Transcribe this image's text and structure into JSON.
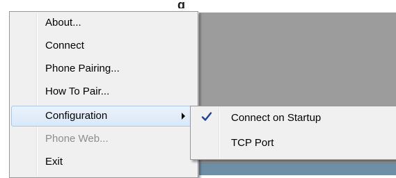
{
  "background": {
    "title_fragment": "g"
  },
  "menu": {
    "items": [
      {
        "label": "About...",
        "enabled": true
      },
      {
        "label": "Connect",
        "enabled": true
      },
      {
        "label": "Phone Pairing...",
        "enabled": true
      },
      {
        "label": "How To Pair...",
        "enabled": true
      },
      {
        "label": "Configuration",
        "enabled": true,
        "has_submenu": true,
        "highlighted": true
      },
      {
        "label": "Phone Web...",
        "enabled": false
      },
      {
        "label": "Exit",
        "enabled": true
      }
    ]
  },
  "submenu": {
    "items": [
      {
        "label": "Connect on Startup",
        "checked": true
      },
      {
        "label": "TCP Port",
        "checked": false
      }
    ]
  },
  "colors": {
    "menu_bg": "#f0f0f0",
    "highlight_border": "#a8c8eb",
    "disabled_text": "#8d8d8d",
    "checkmark": "#1f3f9f"
  },
  "icons": {
    "submenu_arrow": "chevron-right-icon",
    "check": "checkmark-icon"
  }
}
